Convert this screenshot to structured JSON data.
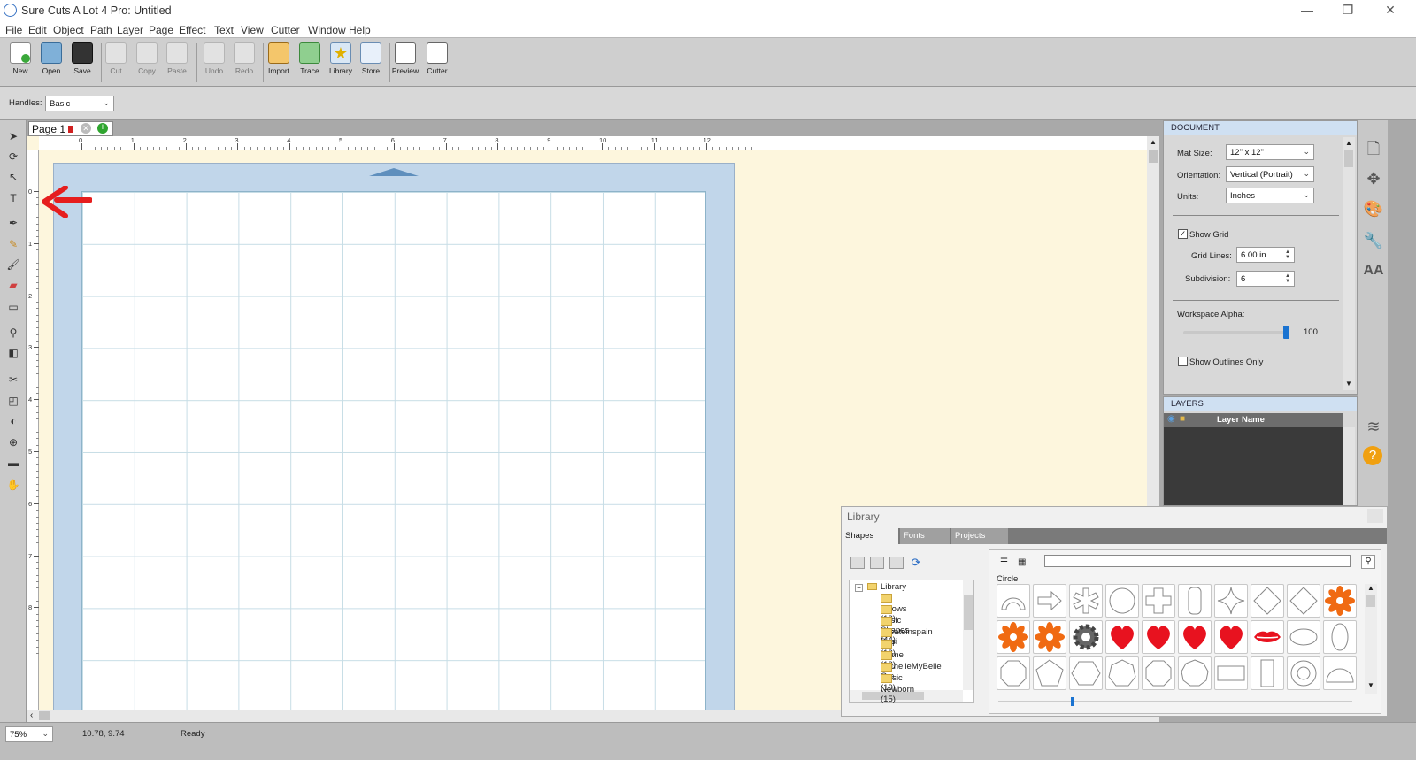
{
  "window": {
    "title": "Sure Cuts A Lot 4 Pro: Untitled",
    "controls": [
      "—",
      "❐",
      "✕"
    ]
  },
  "menu": [
    "File",
    "Edit",
    "Object",
    "Path",
    "Layer",
    "Page",
    "Effect",
    "Text",
    "View",
    "Cutter",
    "Window",
    "Help"
  ],
  "toolbar": {
    "new": "New",
    "open": "Open",
    "save": "Save",
    "cut": "Cut",
    "copy": "Copy",
    "paste": "Paste",
    "undo": "Undo",
    "redo": "Redo",
    "import": "Import",
    "trace": "Trace",
    "library": "Library",
    "store": "Store",
    "preview": "Preview",
    "cutter": "Cutter"
  },
  "options": {
    "handles_label": "Handles:",
    "handles_value": "Basic"
  },
  "page_tab": {
    "label": "Page 1"
  },
  "ruler": {
    "top": [
      "0",
      "1",
      "2",
      "3",
      "4",
      "5",
      "6",
      "7",
      "8",
      "9",
      "10",
      "11",
      "12"
    ],
    "left": [
      "0",
      "1",
      "2",
      "3",
      "4",
      "5",
      "6",
      "7",
      "8"
    ]
  },
  "document": {
    "header": "DOCUMENT",
    "mat_size_label": "Mat Size:",
    "mat_size_value": "12\" x 12\"",
    "orientation_label": "Orientation:",
    "orientation_value": "Vertical (Portrait)",
    "units_label": "Units:",
    "units_value": "Inches",
    "show_grid_label": "Show Grid",
    "show_grid_checked": true,
    "grid_lines_label": "Grid Lines:",
    "grid_lines_value": "6.00 in",
    "subdivision_label": "Subdivision:",
    "subdivision_value": "6",
    "workspace_alpha_label": "Workspace Alpha:",
    "workspace_alpha_value": "100",
    "workspace_alpha_level": 1.0,
    "show_outlines_label": "Show Outlines Only",
    "show_outlines_checked": false
  },
  "layers": {
    "header": "LAYERS",
    "column_name": "Layer Name"
  },
  "library": {
    "title": "Library",
    "tabs": [
      "Shapes",
      "Fonts",
      "Projects"
    ],
    "category_label": "Circle",
    "search_value": "",
    "tree_root": "Library",
    "folders": [
      "Arrows (18)",
      "Basic Shapes (44)",
      "Createinspain Desi",
      "Fall (12)",
      "Game (12)",
      "MichelleMyBelle Cre",
      "Music (10)",
      "Newborn (15)"
    ],
    "shapes": [
      "arch-shape",
      "arrow-shape",
      "asterisk-shape",
      "circle-shape",
      "cross-shape",
      "rounded-rect-shape",
      "star4-shape",
      "diamond-shape",
      "diamond-shape",
      "flower-shape",
      "flower-shape",
      "flower-shape",
      "gear-shape",
      "heart-shape",
      "heart-shape",
      "heart-shape",
      "heart-shape",
      "lips-shape",
      "ellipse-shape",
      "ellipse-vertical-shape",
      "octagon-shape",
      "pentagon-shape",
      "hexagon-shape",
      "heptagon-shape",
      "octagon-shape",
      "nonagon-shape",
      "rectangle-shape",
      "rectangle-vertical-shape",
      "ring-shape",
      "semicircle-shape"
    ]
  },
  "status": {
    "zoom": "75%",
    "coords": "10.78, 9.74",
    "state": "Ready"
  },
  "colors": {
    "mat": "#c1d6ea",
    "workspace": "#fdf6dd",
    "heart": "#e8121f",
    "flower": "#f06a12",
    "panel_header": "#cfe0f2"
  }
}
